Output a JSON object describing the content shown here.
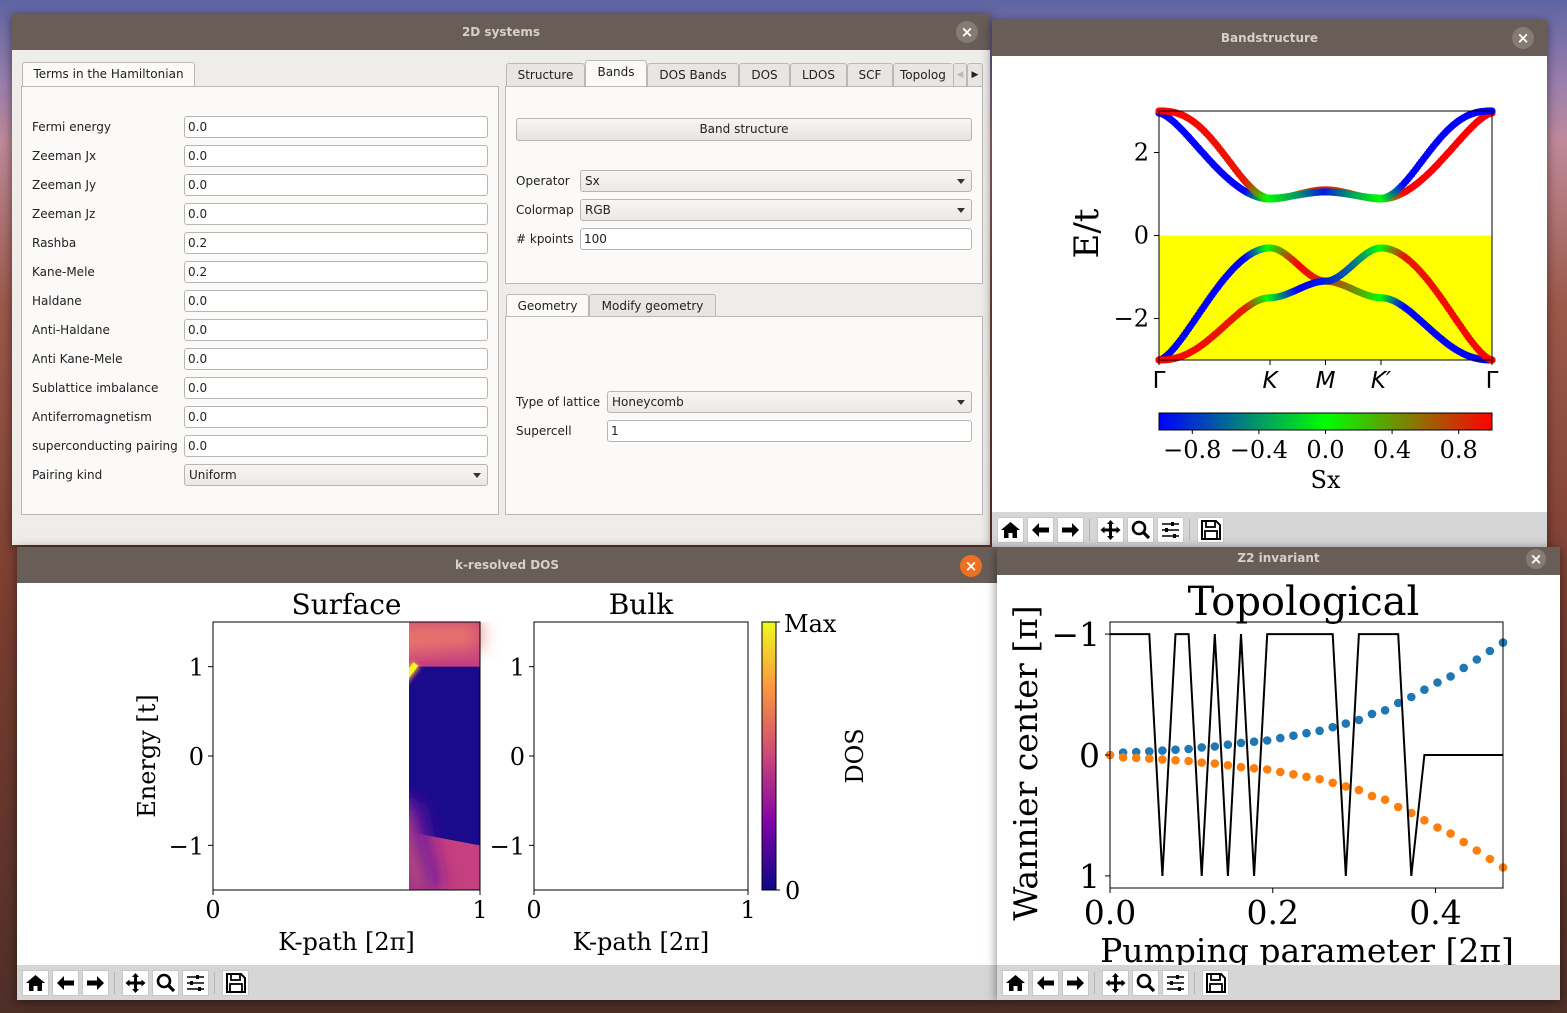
{
  "windows": {
    "main": {
      "title": "2D systems",
      "left_tab": "Terms in the Hamiltonian",
      "params": [
        {
          "label": "Fermi energy",
          "value": "0.0"
        },
        {
          "label": "Zeeman Jx",
          "value": "0.0"
        },
        {
          "label": "Zeeman Jy",
          "value": "0.0"
        },
        {
          "label": "Zeeman Jz",
          "value": "0.0"
        },
        {
          "label": "Rashba",
          "value": "0.2"
        },
        {
          "label": "Kane-Mele",
          "value": "0.2"
        },
        {
          "label": "Haldane",
          "value": "0.0"
        },
        {
          "label": "Anti-Haldane",
          "value": "0.0"
        },
        {
          "label": "Anti Kane-Mele",
          "value": "0.0"
        },
        {
          "label": "Sublattice imbalance",
          "value": "0.0"
        },
        {
          "label": "Antiferromagnetism",
          "value": "0.0"
        },
        {
          "label": "superconducting pairing",
          "value": "0.0"
        }
      ],
      "pairing": {
        "label": "Pairing kind",
        "value": "Uniform"
      },
      "right_tabs": [
        "Structure",
        "Bands",
        "DOS Bands",
        "DOS",
        "LDOS",
        "SCF",
        "Topolog"
      ],
      "active_tab": "Bands",
      "band_button": "Band structure",
      "operator": {
        "label": "Operator",
        "value": "Sx"
      },
      "colormap": {
        "label": "Colormap",
        "value": "RGB"
      },
      "kpoints": {
        "label": "# kpoints",
        "value": "100"
      },
      "geometry_tabs": [
        "Geometry",
        "Modify geometry"
      ],
      "lattice": {
        "label": "Type of lattice",
        "value": "Honeycomb"
      },
      "supercell": {
        "label": "Supercell",
        "value": "1"
      }
    },
    "bandstructure": {
      "title": "Bandstructure"
    },
    "kdos": {
      "title": "k-resolved DOS"
    },
    "z2": {
      "title": "Z2 invariant"
    }
  },
  "toolbar": {
    "icons": [
      "home-icon",
      "back-icon",
      "forward-icon",
      "pan-icon",
      "zoom-icon",
      "configure-icon",
      "save-icon"
    ]
  },
  "colors": {
    "fill_occupied": "#ffff00",
    "plasma_low": "#0d0887",
    "plasma_high": "#f0f921",
    "wannier_1": "#1f77b4",
    "wannier_2": "#ff7f0e",
    "z2_line": "#000000"
  },
  "chart_data": [
    {
      "type": "scatter",
      "ylabel": "E/t",
      "yticks": [
        -2,
        0,
        2
      ],
      "ylim": [
        -3,
        3
      ],
      "xtick_labels": [
        "Γ",
        "K",
        "M",
        "K′",
        "Γ"
      ],
      "fill_below_zero": true,
      "colorbar": {
        "label": "Sx",
        "ticks": [
          "−0.8",
          "−0.4",
          "0.0",
          "0.4",
          "0.8"
        ],
        "range": [
          -1,
          1
        ],
        "colormap": [
          "#0000ff",
          "#00ff00",
          "#ff0000"
        ]
      }
    },
    {
      "type": "heatmap",
      "title": "Surface",
      "xlabel": "K-path [2π]",
      "ylabel": "Energy [t]",
      "xticks": [
        "0",
        "1"
      ],
      "yticks": [
        "−1",
        "0",
        "1"
      ],
      "xlim": [
        0,
        1
      ],
      "ylim": [
        -1.5,
        1.5
      ],
      "colormap": "plasma"
    },
    {
      "type": "heatmap",
      "title": "Bulk",
      "xlabel": "K-path [2π]",
      "xticks": [
        "0",
        "1"
      ],
      "yticks": [
        "−1",
        "0",
        "1"
      ],
      "xlim": [
        0,
        1
      ],
      "ylim": [
        -1.5,
        1.5
      ],
      "colormap": "plasma",
      "colorbar": {
        "label": "DOS",
        "ticks": [
          "0",
          "Max"
        ]
      }
    },
    {
      "type": "scatter",
      "title": "Topological",
      "xlabel": "Pumping parameter [2π]",
      "ylabel": "Wannier center [π]",
      "xticks": [
        "0.0",
        "0.2",
        "0.4"
      ],
      "yticks": [
        "−1",
        "0",
        "1"
      ],
      "xlim": [
        0,
        0.483
      ],
      "ylim": [
        -1.1,
        1.1
      ],
      "x_step": 0.0161,
      "series": [
        {
          "kind": "points",
          "color": "#1f77b4",
          "values": [
            0,
            0.02,
            0.025,
            0.03,
            0.036,
            0.044,
            0.05,
            0.063,
            0.07,
            0.085,
            0.1,
            0.11,
            0.12,
            0.14,
            0.16,
            0.18,
            0.2,
            0.23,
            0.26,
            0.29,
            0.34,
            0.37,
            0.43,
            0.48,
            0.54,
            0.6,
            0.65,
            0.72,
            0.79,
            0.86,
            0.93
          ]
        },
        {
          "kind": "points",
          "color": "#ff7f0e",
          "values": [
            0,
            -0.02,
            -0.025,
            -0.03,
            -0.036,
            -0.044,
            -0.05,
            -0.063,
            -0.07,
            -0.085,
            -0.1,
            -0.11,
            -0.12,
            -0.14,
            -0.16,
            -0.18,
            -0.2,
            -0.23,
            -0.26,
            -0.29,
            -0.34,
            -0.37,
            -0.43,
            -0.48,
            -0.54,
            -0.6,
            -0.65,
            -0.72,
            -0.79,
            -0.86,
            -0.93
          ]
        },
        {
          "kind": "line",
          "color": "#000000",
          "values": [
            1,
            1,
            1,
            1,
            -1,
            1,
            1,
            -1,
            1,
            -1,
            1,
            -1,
            1,
            1,
            1,
            1,
            1,
            1,
            -1,
            1,
            1,
            1,
            1,
            -1,
            0,
            0,
            0,
            0,
            0,
            0,
            0
          ]
        }
      ]
    }
  ]
}
